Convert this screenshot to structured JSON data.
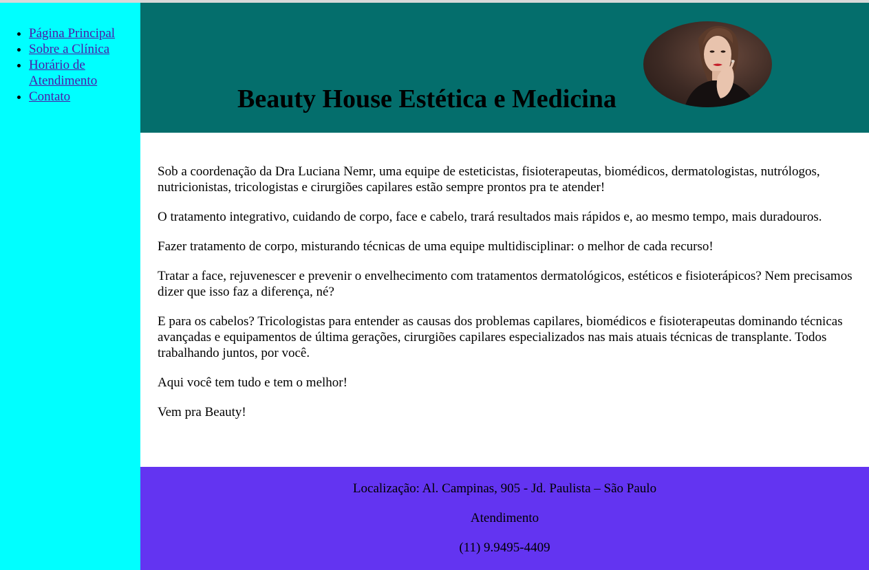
{
  "nav": {
    "items": [
      {
        "label": "Página Principal"
      },
      {
        "label": "Sobre a Clínica"
      },
      {
        "label": "Horário de Atendimento"
      },
      {
        "label": "Contato"
      }
    ]
  },
  "header": {
    "title": "Beauty House Estética e Medicina"
  },
  "main": {
    "paragraphs": [
      "Sob a coordenação da Dra Luciana Nemr, uma equipe de esteticistas, fisioterapeutas, biomédicos, dermatologistas, nutrólogos, nutricionistas, tricologistas e cirurgiões capilares estão sempre prontos pra te atender!",
      "O tratamento integrativo, cuidando de corpo, face e cabelo, trará resultados mais rápidos e, ao mesmo tempo, mais duradouros.",
      "Fazer tratamento de corpo, misturando técnicas de uma equipe multidisciplinar: o melhor de cada recurso!",
      "Tratar a face, rejuvenescer e prevenir o envelhecimento com tratamentos dermatológicos, estéticos e fisioterápicos? Nem precisamos dizer que isso faz a diferença, né?",
      "E para os cabelos? Tricologistas para entender as causas dos problemas capilares, biomédicos e fisioterapeutas dominando técnicas avançadas e equipamentos de última gerações, cirurgiões capilares especializados nas mais atuais técnicas de transplante. Todos trabalhando juntos, por você.",
      "Aqui você tem tudo e tem o melhor!",
      "Vem pra Beauty!"
    ]
  },
  "footer": {
    "location": "Localização: Al. Campinas, 905 - Jd. Paulista – São Paulo",
    "service": "Atendimento",
    "phone": "(11) 9.9495-4409"
  },
  "colors": {
    "sidebar": "#00ffff",
    "header": "#046e6c",
    "footer": "#6334f1",
    "link": "#4b1aa8"
  }
}
